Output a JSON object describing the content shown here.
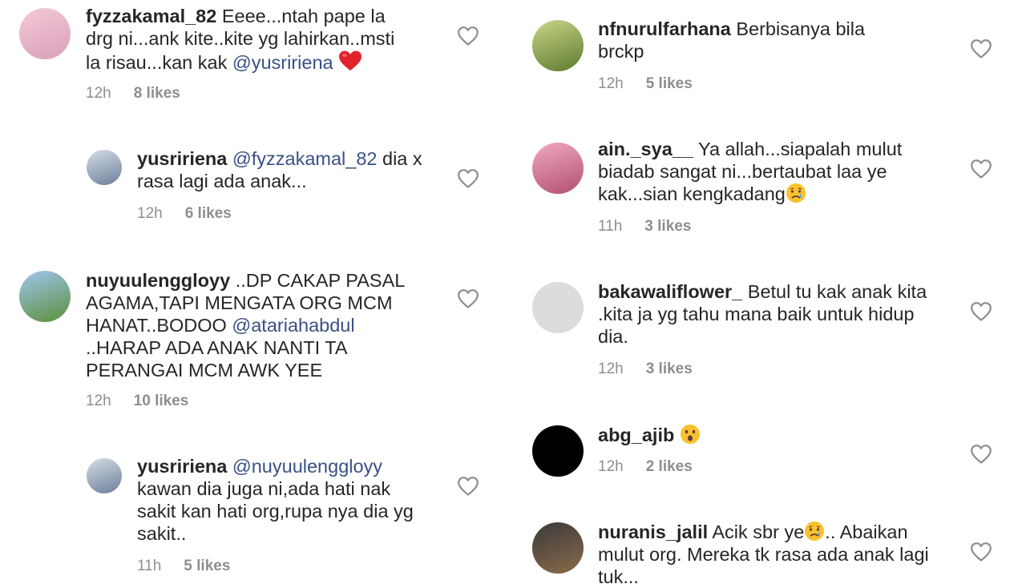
{
  "left": [
    {
      "username": "fyzzakamal_82",
      "before": " Eeee...ntah pape la drg ni...ank kite..kite yg lahirkan..msti la risau...kan kak ",
      "mention": "@yusririena",
      "after": " ",
      "time": "12h",
      "likes": "8 likes",
      "avatar_colors": [
        "#f4c9d9",
        "#d9a0b8"
      ],
      "emoji": "red-heart"
    },
    {
      "username": "yusririena",
      "before": " ",
      "mention": "@fyzzakamal_82",
      "after": " dia x rasa lagi ada anak...",
      "time": "12h",
      "likes": "6 likes",
      "avatar_colors": [
        "#d6dde6",
        "#6b7f9a"
      ]
    },
    {
      "username": "nuyuulenggloyy",
      "before": " ..DP CAKAP PASAL AGAMA,TAPI MENGATA ORG MCM HANAT..BODOO ",
      "mention": "@atariahabdul",
      "after": " ..HARAP ADA ANAK NANTI TA PERANGAI MCM AWK YEE",
      "time": "12h",
      "likes": "10 likes",
      "avatar_colors": [
        "#9fc6ef",
        "#5b8f3a"
      ]
    },
    {
      "username": "yusririena",
      "before": " ",
      "mention": "@nuyuulenggloyy",
      "after": " kawan dia juga ni,ada hati nak sakit kan hati org,rupa nya dia yg sakit..",
      "time": "11h",
      "likes": "5 likes",
      "avatar_colors": [
        "#d6dde6",
        "#6b7f9a"
      ]
    }
  ],
  "right": [
    {
      "username": "nfnurulfarhana",
      "before": " Berbisanya bila brckp",
      "mention": "",
      "after": "",
      "time": "12h",
      "likes": "5 likes",
      "avatar_colors": [
        "#c7d68a",
        "#5f7a2e"
      ]
    },
    {
      "username": "ain._sya__",
      "before": " Ya allah...siapalah mulut biadab sangat ni...bertaubat laa ye kak...sian kengkadang",
      "mention": "",
      "after": "",
      "time": "11h",
      "likes": "3 likes",
      "avatar_colors": [
        "#f2a9c0",
        "#b0506f"
      ],
      "emoji": "crying-face"
    },
    {
      "username": "bakawaliflower_",
      "before": " Betul tu kak anak kita .kita ja yg tahu mana baik untuk hidup dia.",
      "mention": "",
      "after": "",
      "time": "12h",
      "likes": "3 likes",
      "avatar_colors": [
        "#dcdcdc",
        "#dcdcdc"
      ]
    },
    {
      "username": "abg_ajib",
      "before": " ",
      "mention": "",
      "after": "",
      "time": "12h",
      "likes": "2 likes",
      "avatar_colors": [
        "#000000",
        "#000000"
      ],
      "emoji": "surprised-face"
    },
    {
      "username": "nuranis_jalil",
      "before": " Acik sbr ye",
      "mention": "",
      "after": ".. Abaikan mulut org. Mereka tk rasa ada anak lagi tuk...",
      "time": "",
      "likes": "",
      "avatar_colors": [
        "#3a3a3a",
        "#8a6a4a"
      ],
      "emoji": "crying-face",
      "emoji_mid": true
    }
  ]
}
